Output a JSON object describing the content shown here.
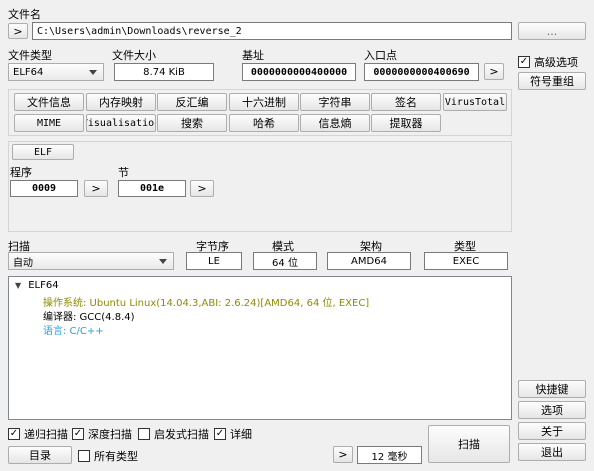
{
  "file": {
    "label": "文件名",
    "browse_label": ">",
    "path": "C:\\Users\\admin\\Downloads\\reverse_2",
    "more_label": "..."
  },
  "info": {
    "type_label": "文件类型",
    "type_value": "ELF64",
    "size_label": "文件大小",
    "size_value": "8.74 KiB",
    "base_label": "基址",
    "base_value": "0000000000400000",
    "entry_label": "入口点",
    "entry_value": "0000000000400690",
    "entry_go": ">"
  },
  "right_panel": {
    "advanced_label": "高级选项",
    "advanced_checked": true,
    "symbol_button": "符号重组",
    "shortcuts": "快捷键",
    "options": "选项",
    "about": "关于",
    "exit": "退出"
  },
  "toolbar": {
    "row1": [
      "文件信息",
      "内存映射",
      "反汇编",
      "十六进制",
      "字符串",
      "签名",
      "VirusTotal"
    ],
    "row2": [
      "MIME",
      "Visualisation",
      "搜索",
      "哈希",
      "信息熵",
      "提取器"
    ]
  },
  "elf": {
    "tab_label": "ELF",
    "programs_label": "程序",
    "programs_value": "0009",
    "programs_go": ">",
    "sections_label": "节",
    "sections_value": "001e",
    "sections_go": ">"
  },
  "scan": {
    "scan_label": "扫描",
    "scan_value": "自动",
    "endian_label": "字节序",
    "endian_value": "LE",
    "mode_label": "模式",
    "mode_value": "64 位",
    "arch_label": "架构",
    "arch_value": "AMD64",
    "type_label": "类型",
    "type_value": "EXEC"
  },
  "results": {
    "root": "ELF64",
    "children": [
      {
        "text": "操作系统: Ubuntu Linux(14.04.3,ABI: 2.6.24)[AMD64, 64 位, EXEC]",
        "color": "#8c8c00"
      },
      {
        "text": "编译器: GCC(4.8.4)",
        "color": "#000000"
      },
      {
        "text": "语言: C/C++",
        "color": "#2a9fd6"
      }
    ]
  },
  "bottom": {
    "recursive": "递归扫描",
    "recursive_checked": true,
    "deep": "深度扫描",
    "deep_checked": true,
    "heuristic": "启发式扫描",
    "heuristic_checked": false,
    "verbose": "详细",
    "verbose_checked": true,
    "dir_button": "目录",
    "all_types": "所有类型",
    "all_types_checked": false,
    "time_go": ">",
    "time_value": "12 毫秒",
    "scan_button": "扫描"
  }
}
